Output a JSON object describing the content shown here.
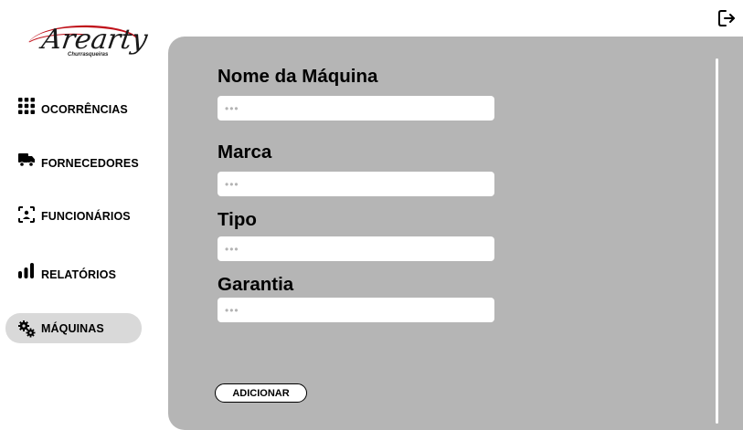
{
  "brand": {
    "name": "Arearty",
    "tagline": "Churrasqueiras",
    "accent_color": "#c0121b"
  },
  "sidebar": {
    "items": [
      {
        "label": "OCORRÊNCIAS",
        "icon": "grid-icon",
        "active": false
      },
      {
        "label": "FORNECEDORES",
        "icon": "truck-icon",
        "active": false
      },
      {
        "label": "FUNCIONÁRIOS",
        "icon": "user-scan-icon",
        "active": false
      },
      {
        "label": "RELATÓRIOS",
        "icon": "bar-chart-icon",
        "active": false
      },
      {
        "label": "MÁQUINAS",
        "icon": "gears-icon",
        "active": true
      }
    ]
  },
  "header": {
    "logout_icon": "logout-icon"
  },
  "form": {
    "fields": [
      {
        "label": "Nome da Máquina",
        "value": "",
        "placeholder": "•••"
      },
      {
        "label": "Marca",
        "value": "",
        "placeholder": "•••"
      },
      {
        "label": "Tipo",
        "value": "",
        "placeholder": "•••"
      },
      {
        "label": "Garantia",
        "value": "",
        "placeholder": "•••"
      }
    ],
    "submit_label": "ADICIONAR"
  },
  "colors": {
    "panel_bg": "#b5b5b5",
    "active_nav_bg": "#d9d9d9"
  }
}
